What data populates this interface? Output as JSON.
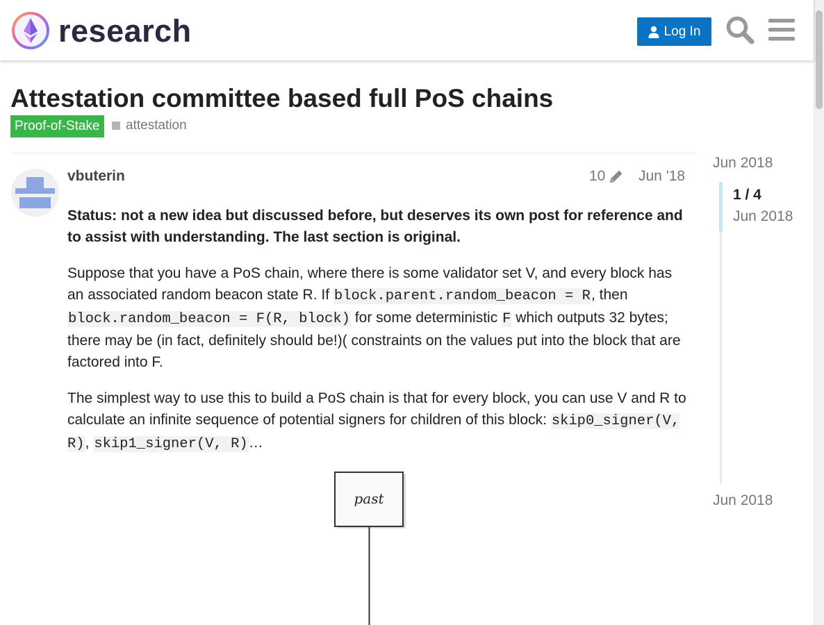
{
  "header": {
    "site_name": "research",
    "login_label": "Log In"
  },
  "topic": {
    "title": "Attestation committee based full PoS chains",
    "category": "Proof-of-Stake",
    "category_color": "#3ab54a",
    "tag": "attestation"
  },
  "post": {
    "username": "vbuterin",
    "edit_count": "10",
    "date": "Jun '18",
    "p1": "Status: not a new idea but discussed before, but deserves its own post for reference and to assist with understanding. The last section is original.",
    "p2": {
      "t1": "Suppose that you have a PoS chain, where there is some validator set V, and every block has an associated random beacon state R. If ",
      "c1": "block.parent.random_beacon = R",
      "t2": ", then ",
      "c2": "block.random_beacon = F(R, block)",
      "t3": " for some deterministic ",
      "c3": "F",
      "t4": " which outputs 32 bytes; there may be (in fact, definitely should be!)( constraints on the values put into the block that are factored into F."
    },
    "p3": {
      "t1": "The simplest way to use this to build a PoS chain is that for every block, you can use V and R to calculate an infinite sequence of potential signers for children of this block: ",
      "c1": "skip0_signer(V, R)",
      "t2": ", ",
      "c2": "skip1_signer(V, R)",
      "t3": "…"
    },
    "diagram_label": "past"
  },
  "timeline": {
    "start_date": "Jun 2018",
    "position": "1 / 4",
    "position_date": "Jun 2018",
    "end_date": "Jun 2018"
  },
  "colors": {
    "accent": "#0a73c4",
    "category": "#3ab54a",
    "timeline_handle": "#c5e5f8"
  }
}
